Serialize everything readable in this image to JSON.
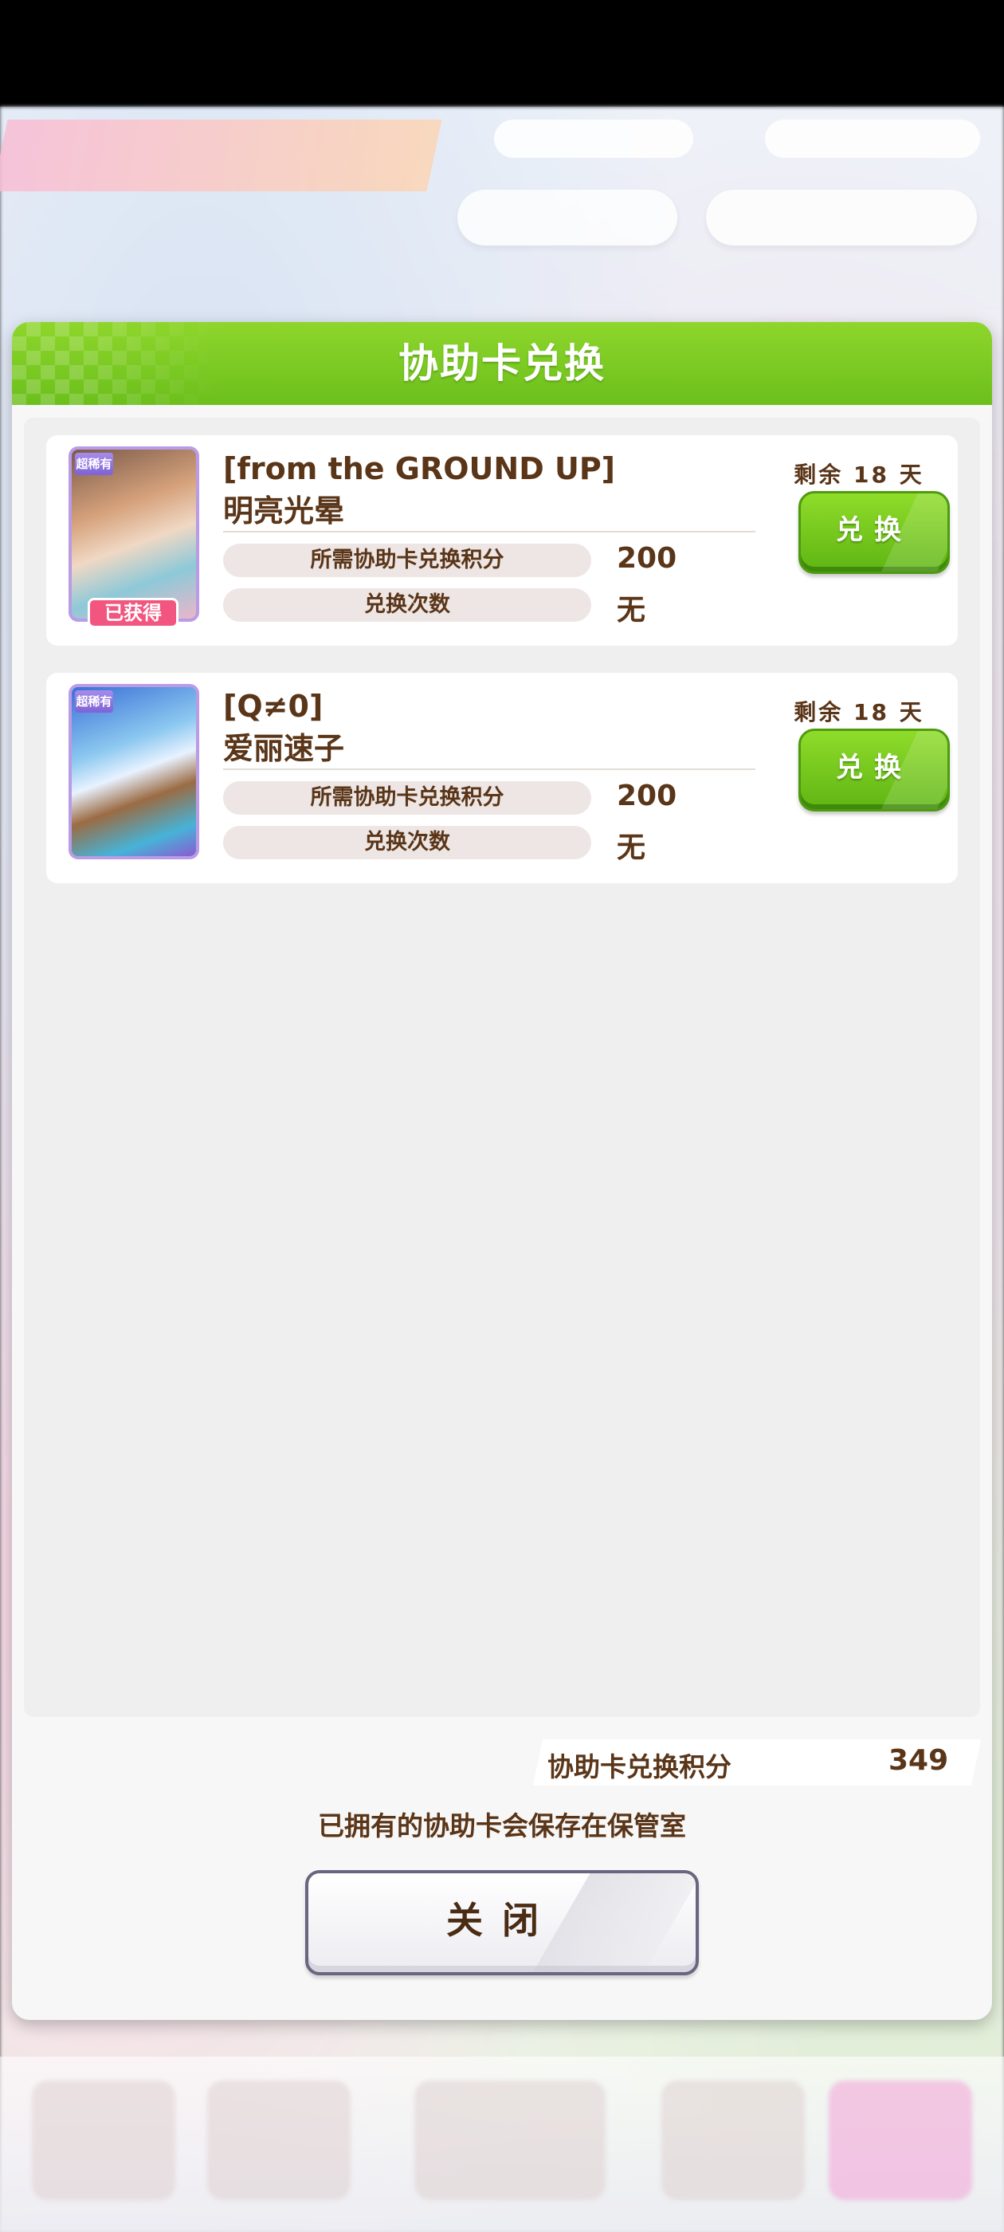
{
  "dialog": {
    "title": "协助卡兑换",
    "cards": [
      {
        "name_line1": "[from the GROUND UP]",
        "name_line2": "明亮光晕",
        "rarity": "超稀有",
        "obtained_badge": "已获得",
        "remaining": "剩余 18 天",
        "points_label": "所需协助卡兑换积分",
        "points_value": "200",
        "count_label": "兑换次数",
        "count_value": "无",
        "button_label": "兑换"
      },
      {
        "name_line1": "[Q≠0]",
        "name_line2": "爱丽速子",
        "rarity": "超稀有",
        "remaining": "剩余 18 天",
        "points_label": "所需协助卡兑换积分",
        "points_value": "200",
        "count_label": "兑换次数",
        "count_value": "无",
        "button_label": "兑换"
      }
    ],
    "footer": {
      "points_label": "协助卡兑换积分",
      "points_value": "349",
      "note": "已拥有的协助卡会保存在保管室",
      "close_label": "关闭"
    }
  },
  "colors": {
    "header_green": "#6cbf1c",
    "text_brown": "#5a3518",
    "button_green": "#5fb513",
    "badge_pink": "#f2557f"
  }
}
